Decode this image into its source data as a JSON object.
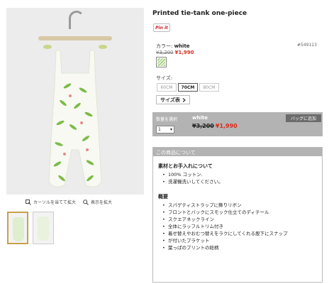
{
  "product": {
    "title": "Printed tie-tank one-piece",
    "pin_label": "Pin it",
    "sku": "#549113"
  },
  "color": {
    "label": "カラー:",
    "value": "white",
    "price_old": "¥3,200",
    "price_new": "¥1,990"
  },
  "size": {
    "label": "サイズ:",
    "options": [
      "60CM",
      "70CM",
      "80CM"
    ],
    "selected": "70CM",
    "chart_button": "サイズ表"
  },
  "cart": {
    "qty_label": "数量を選択",
    "qty_value": "1",
    "color_value": "white",
    "price_old": "¥3,200",
    "price_new": "¥1,990",
    "add_button": "バッグに追加"
  },
  "zoom": {
    "hover_label": "カーソルを当てて拡大",
    "click_label": "表示を拡大"
  },
  "about": {
    "header": "この商品について",
    "material_title": "素材とお手入れについて",
    "material_items": [
      "100% コットン.",
      "洗濯機洗いしてください。"
    ],
    "overview_title": "概要",
    "overview_items": [
      "スパゲティストラップに飾りリボン",
      "フロントとバックにスモック仕立てのディテール",
      "スクエアネックライン",
      "全体にラッフルトリム付き",
      "着せ替えやおむつ替えをラクにしてくれる股下にスナップ",
      "が付いたプラケット",
      "葉っぱのプリントの総柄"
    ]
  },
  "colors": {
    "sale": "#d92b1c",
    "panel_gray": "#b3b3b3",
    "button_dark": "#6b6b6b",
    "print_green": "#7dbb4a"
  }
}
